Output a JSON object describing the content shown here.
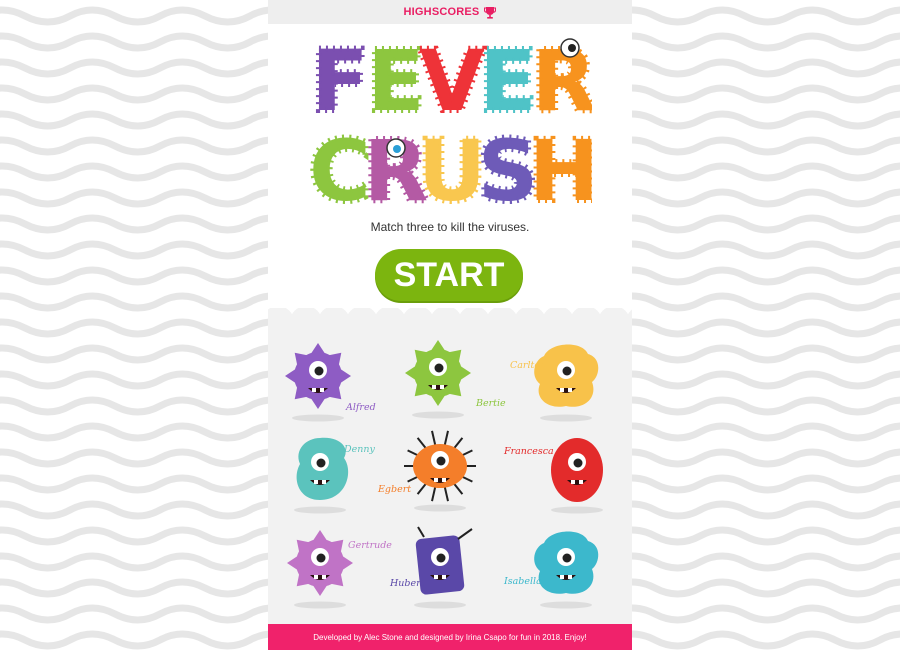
{
  "header": {
    "highscores_label": "HIGHSCORES",
    "trophy_icon": "trophy-icon"
  },
  "title": {
    "line1": [
      "F",
      "E",
      "V",
      "E",
      "R"
    ],
    "line2": [
      "C",
      "R",
      "U",
      "S",
      "H"
    ],
    "line1_colors": [
      "#7b4fb0",
      "#8dc63f",
      "#ee3338",
      "#4fc3c7",
      "#f7931e"
    ],
    "line2_colors": [
      "#8dc63f",
      "#b45aa4",
      "#f9c74f",
      "#6e5bb8",
      "#f7931e"
    ]
  },
  "tagline": "Match three to kill the viruses.",
  "start_label": "START",
  "monsters": [
    {
      "name": "Alfred",
      "color": "#8e5cc4"
    },
    {
      "name": "Bertie",
      "color": "#8dc63f"
    },
    {
      "name": "Carlton",
      "color": "#f8c24a"
    },
    {
      "name": "Denny",
      "color": "#5bc3bd"
    },
    {
      "name": "Egbert",
      "color": "#f47e2a"
    },
    {
      "name": "Francesca",
      "color": "#e32b2b"
    },
    {
      "name": "Gertrude",
      "color": "#c073c6"
    },
    {
      "name": "Hubert",
      "color": "#5a48a8"
    },
    {
      "name": "Isabella",
      "color": "#3cb8cc"
    }
  ],
  "footer": "Developed by Alec Stone and designed by Irina Csapo for fun in 2018. Enjoy!",
  "colors": {
    "accent": "#e91e63",
    "start": "#7cb50f",
    "footer": "#f0226b"
  }
}
